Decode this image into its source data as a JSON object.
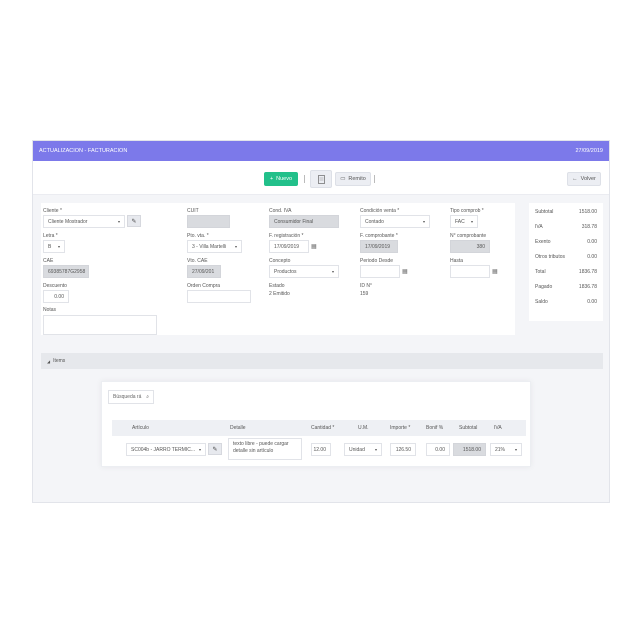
{
  "titlebar": {
    "title": "ACTUALIZACION - FACTURACION",
    "date": "27/09/2019"
  },
  "toolbar": {
    "nuevo_label": "Nuevo",
    "remito_label": "Remito",
    "volver_label": "Volver"
  },
  "form": {
    "cliente": {
      "label": "Cliente *",
      "value": "Cliente Mostrador"
    },
    "cuit": {
      "label": "CUIT",
      "value": ""
    },
    "cond_iva": {
      "label": "Cond. IVA",
      "value": "Consumidor Final"
    },
    "condicion_venta": {
      "label": "Condición venta *",
      "value": "Contado"
    },
    "tipo_comprob": {
      "label": "Tipo comprob *",
      "value": "FAC"
    },
    "letra": {
      "label": "Letra *",
      "value": "B"
    },
    "pto_vta": {
      "label": "Pto. vta. *",
      "value": "3 - Villa Martelli"
    },
    "f_registracion": {
      "label": "F. registración *",
      "value": "17/09/2019"
    },
    "f_comprobante": {
      "label": "F. comprobante *",
      "value": "17/09/2019"
    },
    "n_comprobante": {
      "label": "N° comprobante",
      "value": "380"
    },
    "cae": {
      "label": "CAE",
      "value": "69385787G2958"
    },
    "vto_cae": {
      "label": "Vto. CAE",
      "value": "27/09/201"
    },
    "concepto": {
      "label": "Concepto",
      "value": "Productos"
    },
    "periodo_desde": {
      "label": "Periodo Desde",
      "value": ""
    },
    "hasta": {
      "label": "Hasta",
      "value": ""
    },
    "descuento": {
      "label": "Descuento",
      "value": "0.00"
    },
    "orden_compra": {
      "label": "Orden Compra",
      "value": ""
    },
    "estado": {
      "label": "Estado",
      "value": "2 Emitido"
    },
    "id": {
      "label": "ID N°",
      "value": "159"
    },
    "notas": {
      "label": "Notas",
      "value": ""
    }
  },
  "totals": [
    {
      "label": "Subtotal",
      "value": "1518.00"
    },
    {
      "label": "IVA",
      "value": "318.78"
    },
    {
      "label": "Exento",
      "value": "0.00"
    },
    {
      "label": "Otros tributos",
      "value": "0.00"
    },
    {
      "label": "Total",
      "value": "1836.78"
    },
    {
      "label": "Pagado",
      "value": "1836.78"
    },
    {
      "label": "Saldo",
      "value": "0.00"
    }
  ],
  "items": {
    "section_title": "Items",
    "search_placeholder": "Búsqueda rá",
    "columns": [
      "Artículo",
      "Detalle",
      "Cantidad *",
      "U.M.",
      "Importe *",
      "Bonif %",
      "Subtotal",
      "IVA"
    ],
    "rows": [
      {
        "articulo": "SC004b - JARRO TERMIC...",
        "detalle": "texto libre - puede cargar detalle sin artículo",
        "cantidad": "12.00",
        "um": "Unidad",
        "importe": "126.50",
        "bonif": "0.00",
        "subtotal": "1518.00",
        "iva": "21%"
      }
    ]
  }
}
